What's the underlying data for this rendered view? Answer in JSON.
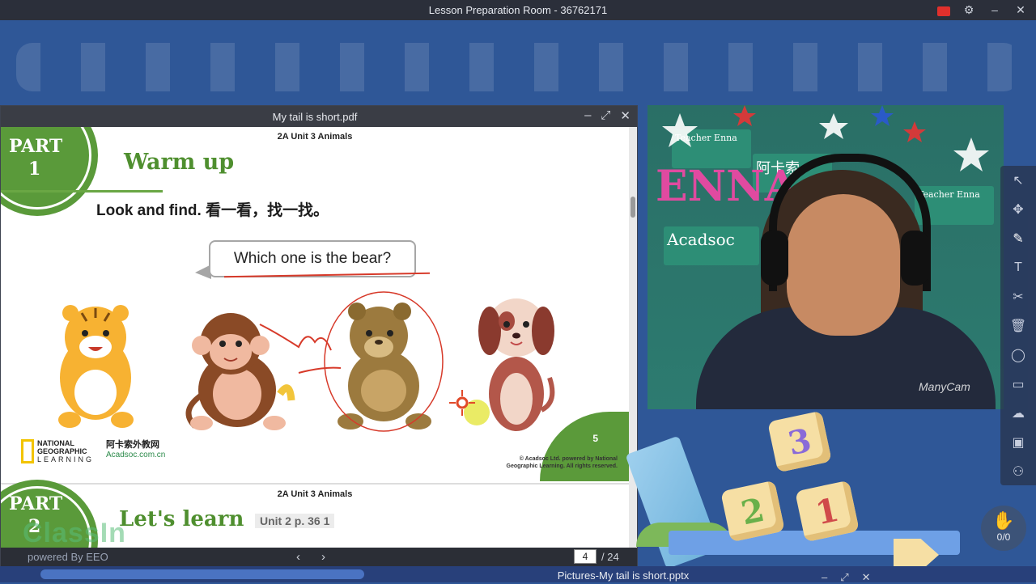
{
  "window": {
    "title": "Lesson Preparation Room - 36762171"
  },
  "pdf": {
    "title": "My tail is short.pdf",
    "page1": {
      "unit_header": "2A Unit 3 Animals",
      "part_label": "PART",
      "part_number": "1",
      "section_title": "Warm up",
      "instruction": "Look and find. 看一看，找一找。",
      "question": "Which one is the bear?",
      "logo_ng": [
        "NATIONAL",
        "GEOGRAPHIC",
        "LEARNING"
      ],
      "logo_acad": {
        "main": "阿卡索外教网",
        "url": "Acadsoc.com.cn"
      },
      "page_number": "5",
      "copyright": "© Acadsoc Ltd. powered by National Geographic Learning. All rights reserved."
    },
    "page2": {
      "unit_header": "2A Unit 3 Animals",
      "part_label": "PART",
      "part_number": "2",
      "section_title": "Let's learn",
      "subtitle": "Unit 2 p. 36  1"
    },
    "footer": {
      "prev": "‹",
      "next": "›",
      "current_page": "4",
      "total": "/ 24"
    }
  },
  "watermark": {
    "brand": "ClassIn",
    "powered": "powered By EEO"
  },
  "video": {
    "overlay_text": "ManyCam",
    "signs": [
      "Teacher Enna",
      "阿卡索",
      "Acadsoc",
      "Teacher Enna",
      "ENNA"
    ]
  },
  "toolbar": {
    "items": [
      "pointer",
      "move",
      "pen",
      "text",
      "scissors",
      "trash",
      "shapes",
      "screen",
      "cloud",
      "toolbox",
      "users"
    ]
  },
  "raise_hand": {
    "count": "0/0"
  },
  "deco_blocks": [
    "3",
    "2",
    "1"
  ],
  "pptx": {
    "title": "Pictures-My tail is short.pptx"
  },
  "colors": {
    "accent_green": "#5a9a3a",
    "app_blue": "#2f5797",
    "annotation_red": "#d73a2a"
  }
}
